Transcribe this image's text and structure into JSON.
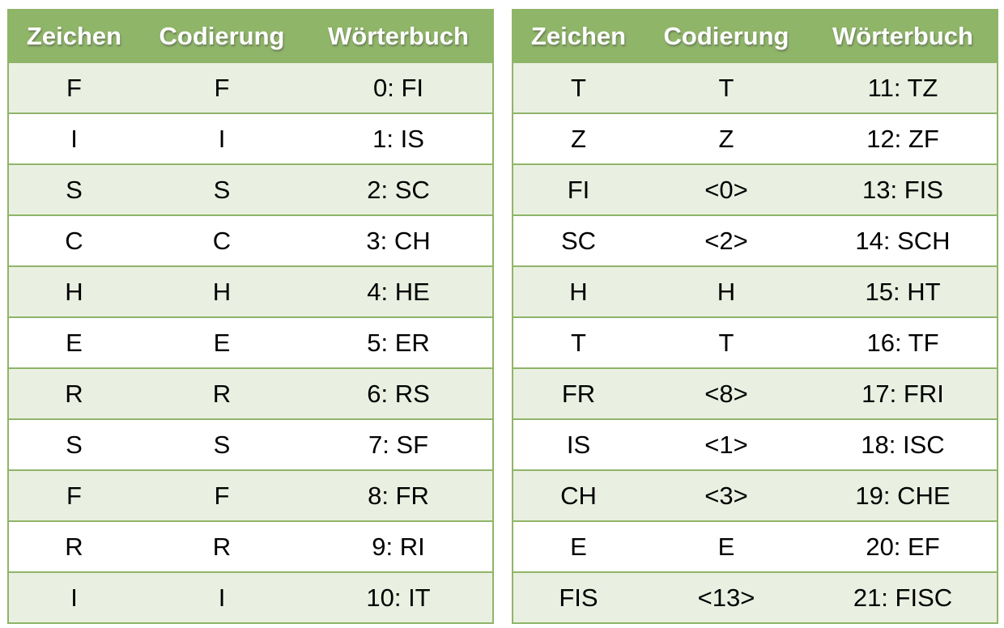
{
  "colors": {
    "header_bg": "#8fb569",
    "row_alt_bg": "#eaf0e1",
    "row_bg": "#ffffff",
    "border": "#8fb569"
  },
  "headers": {
    "zeichen": "Zeichen",
    "codierung": "Codierung",
    "woerterbuch": "Wörterbuch"
  },
  "left": {
    "rows": [
      {
        "zeichen": "F",
        "codierung": "F",
        "woerterbuch": "0: FI"
      },
      {
        "zeichen": "I",
        "codierung": "I",
        "woerterbuch": "1: IS"
      },
      {
        "zeichen": "S",
        "codierung": "S",
        "woerterbuch": "2: SC"
      },
      {
        "zeichen": "C",
        "codierung": "C",
        "woerterbuch": "3: CH"
      },
      {
        "zeichen": "H",
        "codierung": "H",
        "woerterbuch": "4: HE"
      },
      {
        "zeichen": "E",
        "codierung": "E",
        "woerterbuch": "5: ER"
      },
      {
        "zeichen": "R",
        "codierung": "R",
        "woerterbuch": "6: RS"
      },
      {
        "zeichen": "S",
        "codierung": "S",
        "woerterbuch": "7: SF"
      },
      {
        "zeichen": "F",
        "codierung": "F",
        "woerterbuch": "8: FR"
      },
      {
        "zeichen": "R",
        "codierung": "R",
        "woerterbuch": "9: RI"
      },
      {
        "zeichen": "I",
        "codierung": "I",
        "woerterbuch": "10: IT"
      }
    ]
  },
  "right": {
    "rows": [
      {
        "zeichen": "T",
        "codierung": "T",
        "woerterbuch": "11: TZ"
      },
      {
        "zeichen": "Z",
        "codierung": "Z",
        "woerterbuch": "12: ZF"
      },
      {
        "zeichen": "FI",
        "codierung": "<0>",
        "woerterbuch": "13: FIS"
      },
      {
        "zeichen": "SC",
        "codierung": "<2>",
        "woerterbuch": "14: SCH"
      },
      {
        "zeichen": "H",
        "codierung": "H",
        "woerterbuch": "15: HT"
      },
      {
        "zeichen": "T",
        "codierung": "T",
        "woerterbuch": "16: TF"
      },
      {
        "zeichen": "FR",
        "codierung": "<8>",
        "woerterbuch": "17: FRI"
      },
      {
        "zeichen": "IS",
        "codierung": "<1>",
        "woerterbuch": "18: ISC"
      },
      {
        "zeichen": "CH",
        "codierung": "<3>",
        "woerterbuch": "19: CHE"
      },
      {
        "zeichen": "E",
        "codierung": "E",
        "woerterbuch": "20: EF"
      },
      {
        "zeichen": "FIS",
        "codierung": "<13>",
        "woerterbuch": "21: FISC"
      }
    ]
  }
}
